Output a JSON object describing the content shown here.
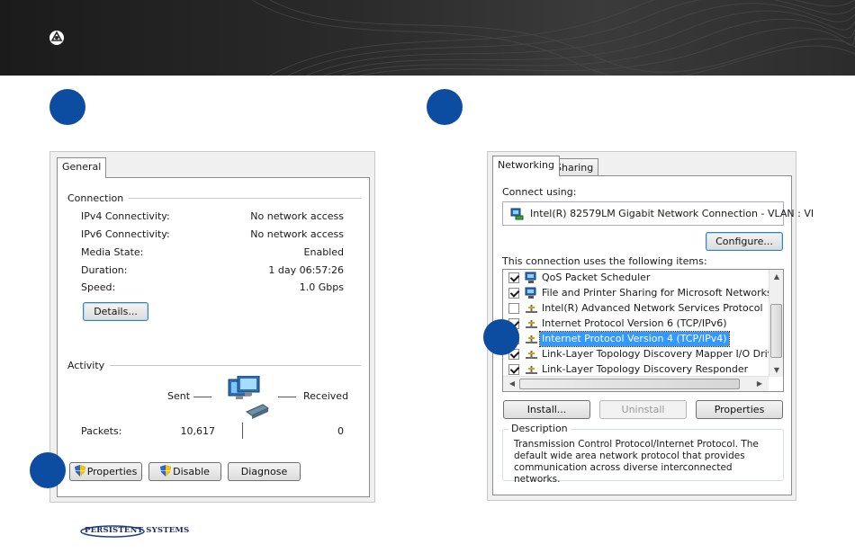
{
  "header": {
    "logo_icon": "persistent-logo-icon"
  },
  "left_dialog": {
    "tab_general": "General",
    "connection": {
      "label": "Connection",
      "rows": [
        {
          "key": "IPv4 Connectivity:",
          "value": "No network access"
        },
        {
          "key": "IPv6 Connectivity:",
          "value": "No network access"
        },
        {
          "key": "Media State:",
          "value": "Enabled"
        },
        {
          "key": "Duration:",
          "value": "1 day 06:57:26"
        },
        {
          "key": "Speed:",
          "value": "1.0 Gbps"
        }
      ],
      "details_button": "Details..."
    },
    "activity": {
      "label": "Activity",
      "sent": "Sent",
      "received": "Received",
      "packets_label": "Packets:",
      "packets_sent": "10,617",
      "packets_received": "0"
    },
    "buttons": {
      "properties": "Properties",
      "disable": "Disable",
      "diagnose": "Diagnose"
    }
  },
  "right_dialog": {
    "tab_networking": "Networking",
    "tab_sharing": "Sharing",
    "connect_using_label": "Connect using:",
    "adapter": "Intel(R) 82579LM Gigabit Network Connection - VLAN : VI",
    "configure_button": "Configure...",
    "items_label": "This connection uses the following items:",
    "items": [
      {
        "label": "QoS Packet Scheduler",
        "checked": true,
        "icon": "qos-icon"
      },
      {
        "label": "File and Printer Sharing for Microsoft Networks",
        "checked": true,
        "icon": "file-sharing-icon"
      },
      {
        "label": "Intel(R) Advanced Network Services Protocol",
        "checked": false,
        "icon": "protocol-icon"
      },
      {
        "label": "Internet Protocol Version 6 (TCP/IPv6)",
        "checked": true,
        "icon": "protocol-icon"
      },
      {
        "label": "Internet Protocol Version 4 (TCP/IPv4)",
        "checked": true,
        "icon": "protocol-icon",
        "selected": true
      },
      {
        "label": "Link-Layer Topology Discovery Mapper I/O Driver",
        "checked": true,
        "icon": "protocol-icon"
      },
      {
        "label": "Link-Layer Topology Discovery Responder",
        "checked": true,
        "icon": "protocol-icon"
      }
    ],
    "buttons": {
      "install": "Install...",
      "uninstall": "Uninstall",
      "properties": "Properties"
    },
    "description_label": "Description",
    "description_text": "Transmission Control Protocol/Internet Protocol. The default wide area network protocol that provides communication across diverse interconnected networks."
  },
  "footer": {
    "brand": "PERSISTENT SYSTEMS"
  },
  "colors": {
    "step_marker": "#0d4da1",
    "selection": "#3399ff",
    "header_dark": "#2a2a2a"
  }
}
